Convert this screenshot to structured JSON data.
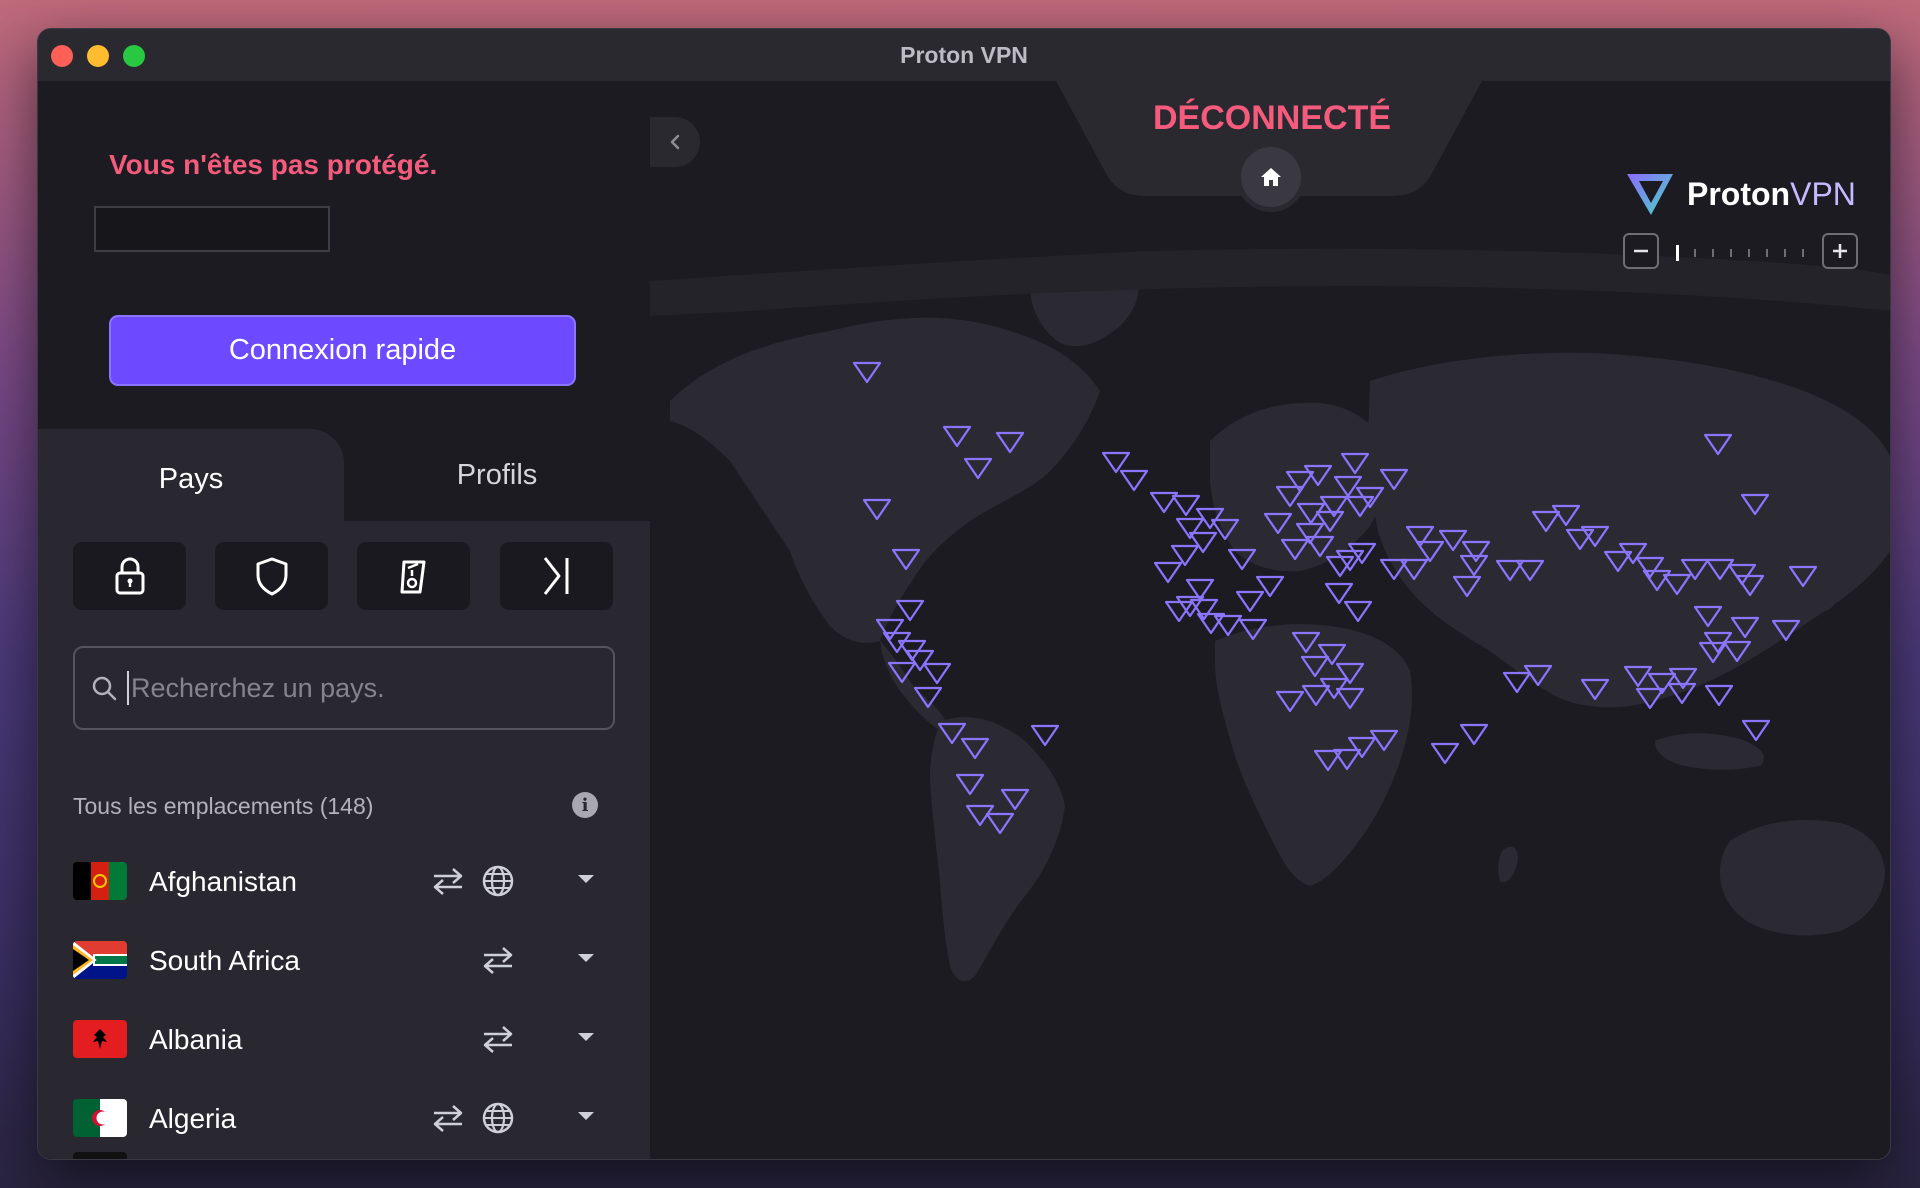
{
  "window": {
    "title": "Proton VPN"
  },
  "connection": {
    "status_message": "Vous n'êtes pas protégé.",
    "quick_connect_label": "Connexion rapide",
    "map_status": "DÉCONNECTÉ"
  },
  "tabs": [
    {
      "label": "Pays",
      "active": true
    },
    {
      "label": "Profils",
      "active": false
    }
  ],
  "feature_filters": [
    {
      "icon": "secure-core-lock-icon"
    },
    {
      "icon": "netshield-icon"
    },
    {
      "icon": "streaming-icon"
    },
    {
      "icon": "collapse-all-icon"
    }
  ],
  "search": {
    "placeholder": "Recherchez un pays.",
    "value": ""
  },
  "locations": {
    "header": "Tous les emplacements (148)",
    "countries": [
      {
        "name": "Afghanistan",
        "p2p": true,
        "tor": true,
        "flag": "afghanistan"
      },
      {
        "name": "South Africa",
        "p2p": true,
        "tor": false,
        "flag": "south-africa"
      },
      {
        "name": "Albania",
        "p2p": true,
        "tor": false,
        "flag": "albania"
      },
      {
        "name": "Algeria",
        "p2p": true,
        "tor": true,
        "flag": "algeria"
      }
    ]
  },
  "brand": {
    "proton": "Proton",
    "vpn": "VPN",
    "accent": "#6d4aff"
  },
  "zoom": {
    "level": 0,
    "steps": 8
  },
  "colors": {
    "danger": "#f55b7c",
    "primary": "#6d4aff",
    "marker": "#8b75ff"
  }
}
